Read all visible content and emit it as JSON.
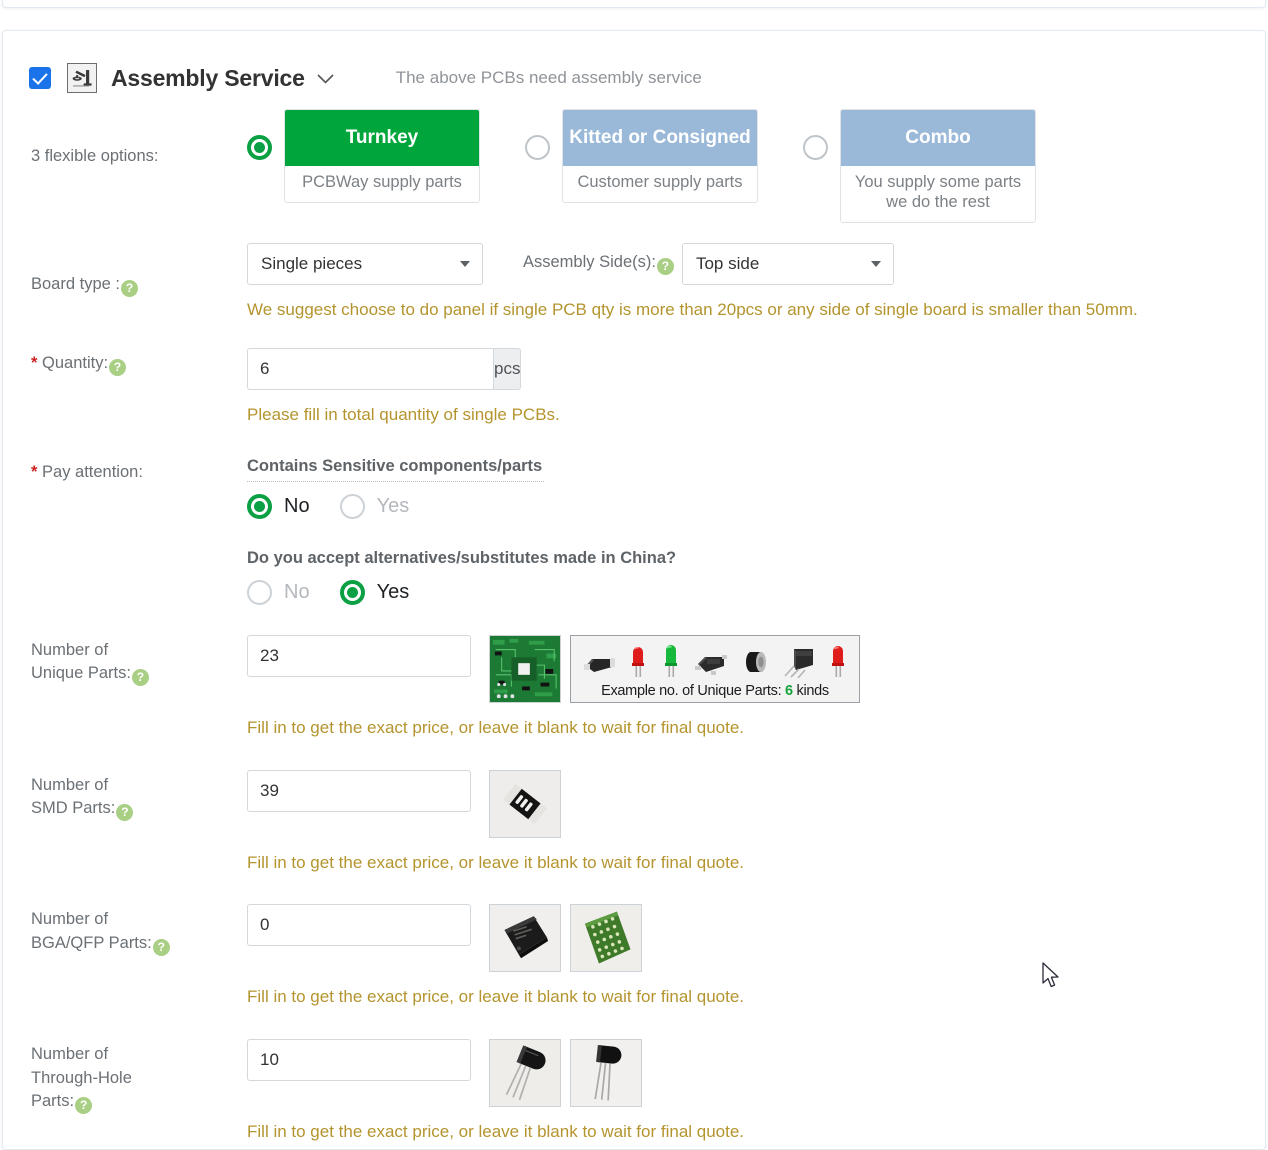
{
  "header": {
    "checkbox_checked": true,
    "icon": "assembly-robot-icon",
    "title": "Assembly Service",
    "caret": "⌄",
    "note": "The above PCBs need assembly service"
  },
  "options": {
    "label": "3 flexible options:",
    "selected_index": 0,
    "items": [
      {
        "title": "Turnkey",
        "subtitle": "PCBWay supply parts",
        "color": "#00a63c",
        "selected": true
      },
      {
        "title": "Kitted or Consigned",
        "subtitle": "Customer supply parts",
        "color": "#9ab8d8",
        "selected": false
      },
      {
        "title": "Combo",
        "subtitle": "You supply some parts we do the rest",
        "color": "#9ab8d8",
        "selected": false
      }
    ]
  },
  "board": {
    "label": "Board type :",
    "value": "Single pieces",
    "side_label": "Assembly Side(s):",
    "side_value": "Top side",
    "hint": "We suggest choose to do panel if single PCB qty is more than 20pcs or any side of single board is smaller than 50mm."
  },
  "quantity": {
    "required_mark": "*",
    "label": " Quantity:",
    "value": "6",
    "unit": "pcs",
    "hint": "Please fill in total quantity of single PCBs."
  },
  "pay_attention": {
    "required_mark": "*",
    "label": " Pay attention:",
    "q1": {
      "title": "Contains Sensitive components/parts",
      "no_label": "No",
      "yes_label": "Yes",
      "selected": "No"
    },
    "q2": {
      "title": "Do you accept alternatives/substitutes made in China?",
      "no_label": "No",
      "yes_label": "Yes",
      "selected": "Yes"
    }
  },
  "parts": {
    "hint": "Fill in to get the exact price, or leave it blank to wait for final quote.",
    "unique": {
      "label_line1": "Number of",
      "label_line2": "Unique Parts:",
      "value": "23",
      "example_caption_prefix": "Example no. of Unique Parts: ",
      "example_caption_count": "6",
      "example_caption_suffix": " kinds"
    },
    "smd": {
      "label_line1": "Number of",
      "label_line2": "SMD Parts:",
      "value": "39"
    },
    "bga": {
      "label_line1": "Number of",
      "label_line2": "BGA/QFP Parts:",
      "value": "0"
    },
    "tht": {
      "label_line1": "Number of",
      "label_line2": "Through-Hole",
      "label_line3": "Parts:",
      "value": "10"
    }
  },
  "colors": {
    "accent_green": "#00a63c",
    "option_blue": "#9ab8d8",
    "hint_gold": "#b4942e",
    "checkbox_blue": "#1a73e8",
    "help_green": "#a9cf85"
  }
}
